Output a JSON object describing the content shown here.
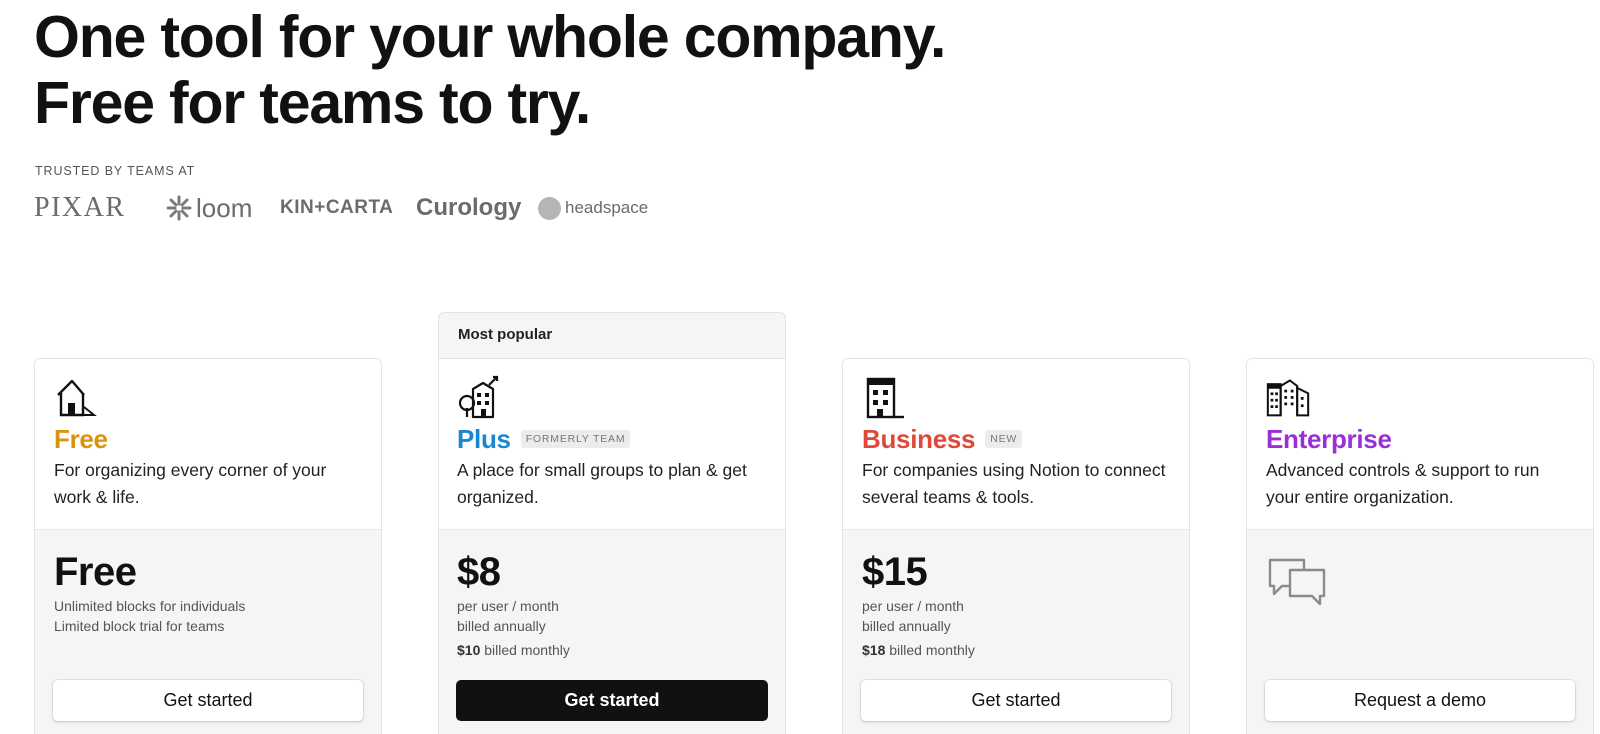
{
  "headline": {
    "line1": "One tool for your whole company.",
    "line2": "Free for teams to try."
  },
  "trusted": {
    "label": "TRUSTED BY TEAMS AT",
    "logos": [
      "PIXAR",
      "loom",
      "KIN+CARTA",
      "Curology",
      "headspace"
    ]
  },
  "plans": [
    {
      "name": "Free",
      "color": "#d9930d",
      "icon": "house-icon",
      "badge": "",
      "description": "For organizing every corner of your work & life.",
      "price": "Free",
      "price_lines": [
        "Unlimited blocks for individuals",
        "Limited block trial for teams"
      ],
      "monthly_amount": "",
      "monthly_text": "",
      "cta": "Get started"
    },
    {
      "name": "Plus",
      "color": "#1b86d6",
      "icon": "small-building-icon",
      "badge": "FORMERLY TEAM",
      "banner": "Most popular",
      "description": "A place for small groups to plan & get organized.",
      "price": "$8",
      "price_lines": [
        "per user / month",
        "billed annually"
      ],
      "monthly_amount": "$10",
      "monthly_text": "billed monthly",
      "cta": "Get started"
    },
    {
      "name": "Business",
      "color": "#e0483a",
      "icon": "office-building-icon",
      "badge": "NEW",
      "description": "For companies using Notion to connect several teams & tools.",
      "price": "$15",
      "price_lines": [
        "per user / month",
        "billed annually"
      ],
      "monthly_amount": "$18",
      "monthly_text": "billed monthly",
      "cta": "Get started"
    },
    {
      "name": "Enterprise",
      "color": "#9a2fd8",
      "icon": "city-buildings-icon",
      "badge": "",
      "description": "Advanced controls & support to run your entire organization.",
      "price_icon": "chat-bubbles-icon",
      "cta": "Request a demo"
    }
  ]
}
